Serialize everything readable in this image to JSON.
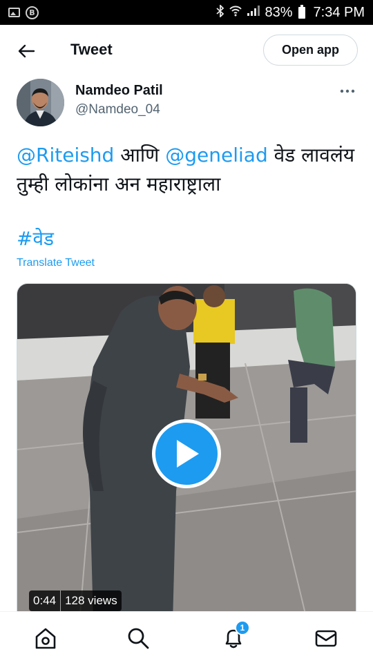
{
  "status_bar": {
    "battery": "83%",
    "time": "7:34 PM",
    "icons": [
      "image-icon",
      "b-circle-icon",
      "bluetooth-icon",
      "wifi-icon",
      "signal-icon",
      "battery-icon"
    ]
  },
  "header": {
    "title": "Tweet",
    "open_app_label": "Open app"
  },
  "author": {
    "name": "Namdeo Patil",
    "handle": "@Namdeo_04"
  },
  "tweet": {
    "mention_1": "@Riteishd",
    "text_1": " आणि ",
    "mention_2": "@geneliad",
    "text_2": "  वेड लावलंय तुम्ही लोकांना अन महाराष्ट्राला",
    "hashtag": "#वेड",
    "translate_label": "Translate Tweet"
  },
  "video": {
    "duration": "0:44",
    "views": "128 views"
  },
  "bottom_nav": {
    "items": [
      "home-icon",
      "search-icon",
      "notifications-icon",
      "messages-icon"
    ],
    "notification_badge": "1"
  },
  "colors": {
    "accent": "#1d9bf0",
    "text": "#0f1419",
    "secondary": "#536471"
  }
}
